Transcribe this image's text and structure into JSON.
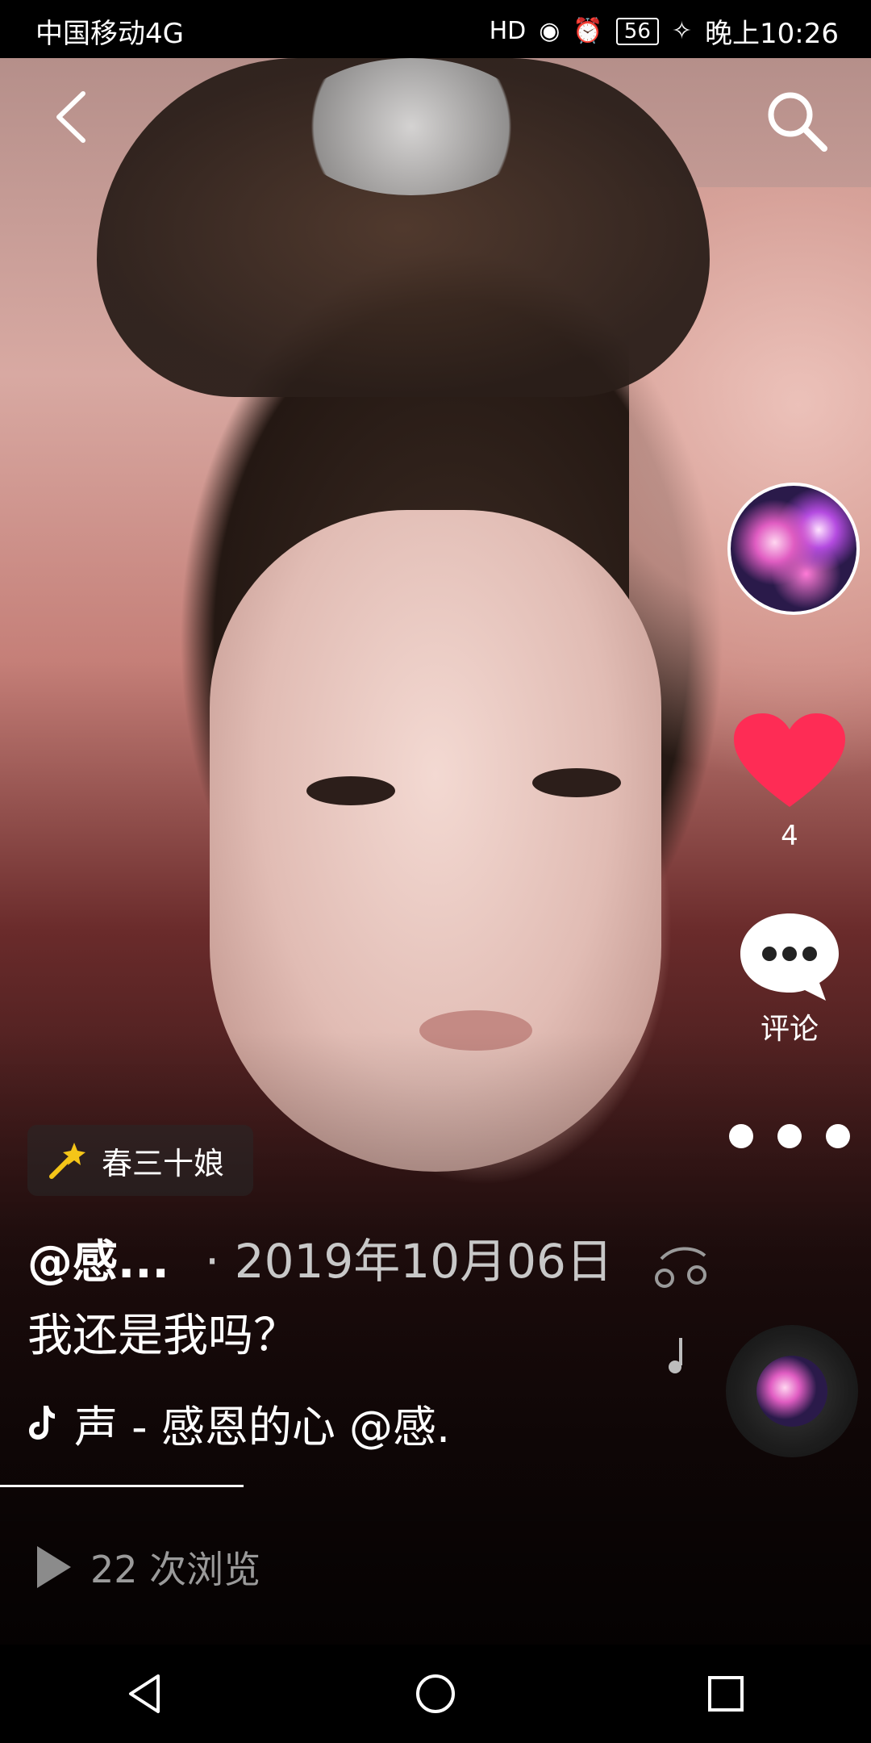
{
  "status_bar": {
    "carrier": "中国移动4G",
    "signal_label": "4G",
    "battery": "56",
    "time": "晚上10:26",
    "icons": [
      "hd-icon",
      "eye-icon",
      "alarm-icon",
      "battery-icon",
      "leaf-icon"
    ]
  },
  "top_bar": {
    "back_icon": "chevron-left-icon",
    "search_icon": "search-icon"
  },
  "right_rail": {
    "like_count": "4",
    "comment_label": "评论",
    "more_icon": "more-dots-icon"
  },
  "effect": {
    "label": "春三十娘"
  },
  "post": {
    "author": "@感...",
    "date": "· 2019年10月06日",
    "caption": "我还是我吗？",
    "music": "声 - 感恩的心    @感."
  },
  "views": {
    "text": "22 次浏览"
  },
  "colors": {
    "like": "#fe2c55",
    "text_secondary": "#9a9a9a"
  },
  "nav": {
    "icons": [
      "back-triangle-icon",
      "home-circle-icon",
      "recents-square-icon"
    ]
  }
}
